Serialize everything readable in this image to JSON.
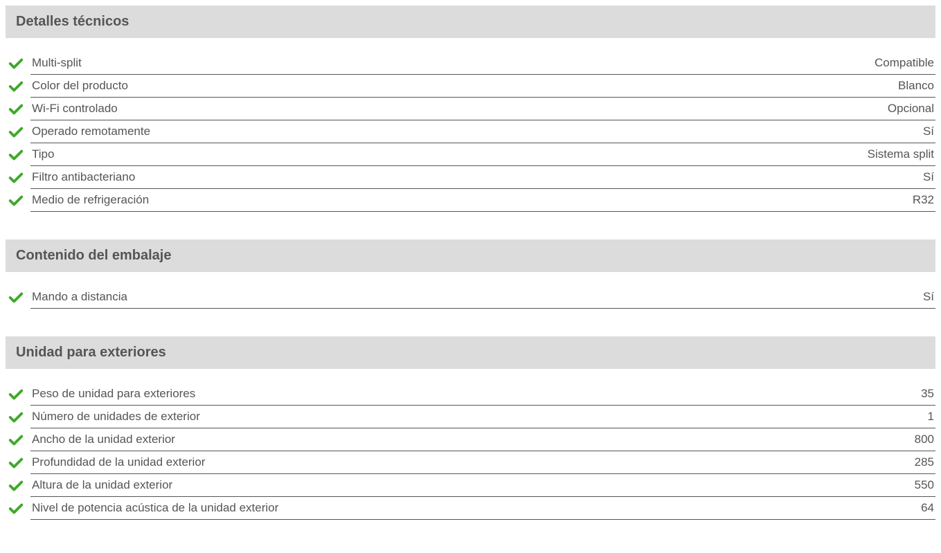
{
  "sections": [
    {
      "title": "Detalles técnicos",
      "rows": [
        {
          "label": "Multi-split",
          "value": "Compatible"
        },
        {
          "label": "Color del producto",
          "value": "Blanco"
        },
        {
          "label": "Wi-Fi controlado",
          "value": "Opcional"
        },
        {
          "label": "Operado remotamente",
          "value": "Sí"
        },
        {
          "label": "Tipo",
          "value": "Sistema split"
        },
        {
          "label": "Filtro antibacteriano",
          "value": "Sí"
        },
        {
          "label": "Medio de refrigeración",
          "value": "R32"
        }
      ]
    },
    {
      "title": "Contenido del embalaje",
      "rows": [
        {
          "label": "Mando a distancia",
          "value": "Sí"
        }
      ]
    },
    {
      "title": "Unidad para exteriores",
      "rows": [
        {
          "label": "Peso de unidad para exteriores",
          "value": "35"
        },
        {
          "label": "Número de unidades de exterior",
          "value": "1"
        },
        {
          "label": "Ancho de la unidad exterior",
          "value": "800"
        },
        {
          "label": "Profundidad de la unidad exterior",
          "value": "285"
        },
        {
          "label": "Altura de la unidad exterior",
          "value": "550"
        },
        {
          "label": "Nivel de potencia acústica de la unidad exterior",
          "value": "64"
        }
      ]
    }
  ]
}
